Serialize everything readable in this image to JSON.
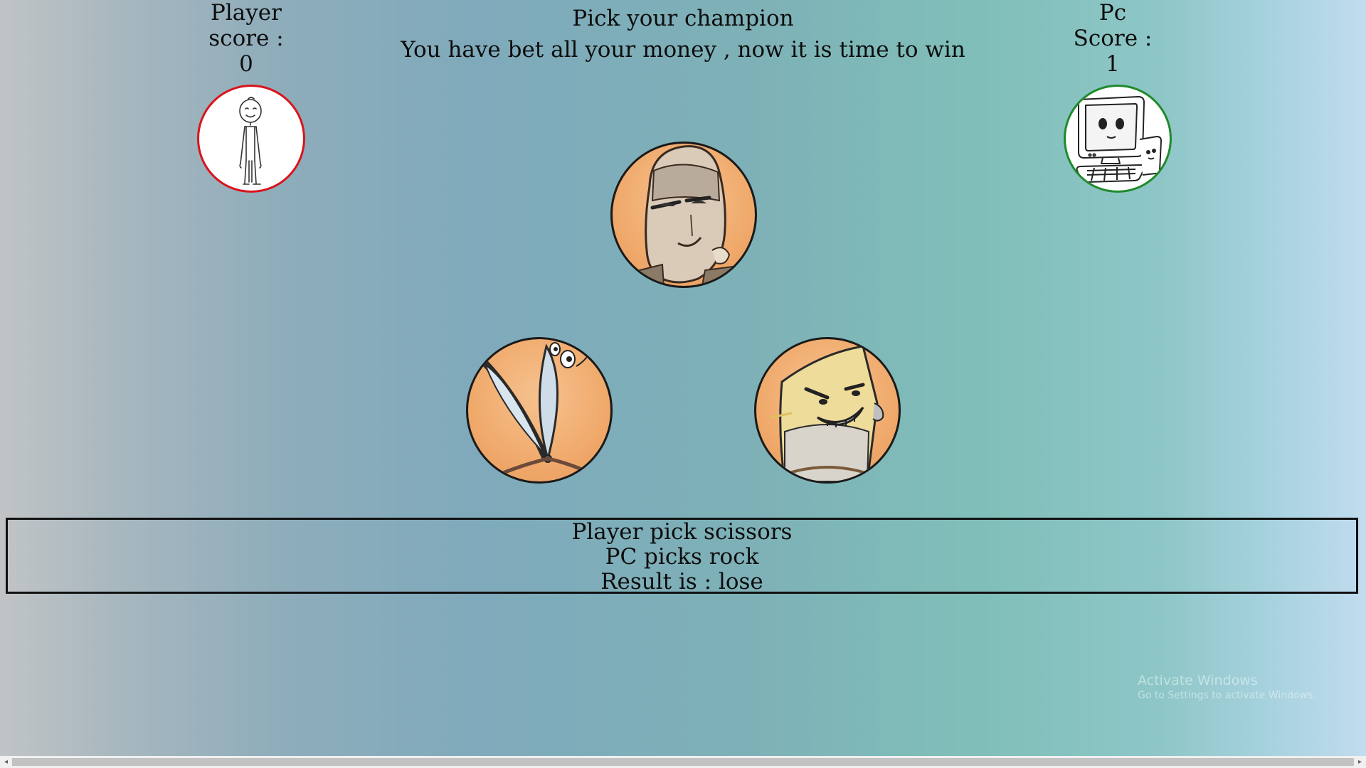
{
  "player": {
    "label": "Player",
    "score_label": "score :",
    "score": "0",
    "avatar_icon": "stick-figure-icon",
    "avatar_border": "#d9141c"
  },
  "pc": {
    "label": "Pc",
    "score_label": "Score :",
    "score": "1",
    "avatar_icon": "computer-character-icon",
    "avatar_border": "#1f8a2c"
  },
  "header": {
    "title": "Pick your champion",
    "subtitle": "You have bet all your money , now it is time to win"
  },
  "choices": [
    {
      "name": "rock",
      "icon": "rock-character-icon"
    },
    {
      "name": "scissors",
      "icon": "scissors-character-icon"
    },
    {
      "name": "paper",
      "icon": "paper-character-icon"
    }
  ],
  "result": {
    "player_pick": "Player pick scissors",
    "pc_pick": "PC picks rock",
    "outcome": "Result is : lose"
  },
  "watermark": {
    "line1": "Activate Windows",
    "line2": "Go to Settings to activate Windows."
  },
  "scrollbar": {
    "left_arrow": "◂",
    "right_arrow": "▸"
  }
}
